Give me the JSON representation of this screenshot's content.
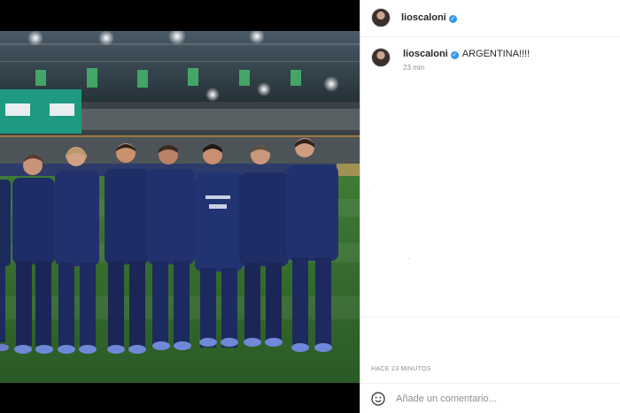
{
  "post": {
    "username": "lioscaloni",
    "verified": true,
    "caption": "ARGENTINA!!!!",
    "time_short": "23 min",
    "time_long": "HACE 23 MINUTOS"
  },
  "comment_box": {
    "placeholder": "Añade un comentario..."
  },
  "icons": {
    "verified": "verified-badge-icon",
    "more": "more-options-icon",
    "emoji": "emoji-icon"
  },
  "colors": {
    "verified_blue": "#3897f0",
    "pitch_green": "#2f6a2c",
    "kit_navy": "#1d2a5c"
  }
}
